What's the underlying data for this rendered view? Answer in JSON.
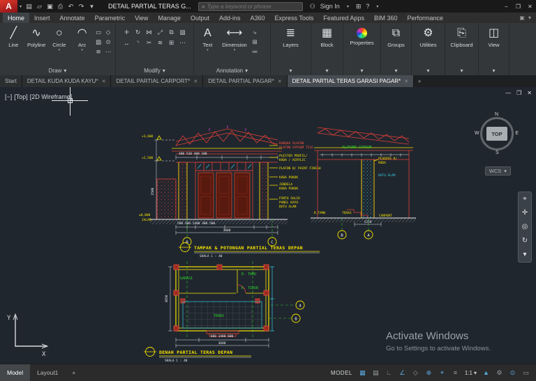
{
  "colors": {
    "viewport_bg": "#20262e",
    "cad_red": "#e04038",
    "cad_yellow": "#f5e400",
    "cad_cyan": "#35cbe0",
    "cad_green": "#2ad42a",
    "cad_white": "#e8edf1",
    "status_active_blue": "#57a8e0",
    "logo_red": "#c42b1c"
  },
  "titlebar": {
    "logo": "A",
    "logo_caret": "▾",
    "qa": [
      {
        "glyph": "▤",
        "name": "new"
      },
      {
        "glyph": "▱",
        "name": "open"
      },
      {
        "glyph": "▣",
        "name": "save"
      },
      {
        "glyph": "⎙",
        "name": "plot"
      },
      {
        "glyph": "↶",
        "name": "undo"
      },
      {
        "glyph": "↷",
        "name": "redo"
      },
      {
        "glyph": "▾",
        "name": "customize"
      }
    ],
    "title": "DETAIL PARTIAL TERAS G...",
    "search": {
      "icon": "⌕",
      "placeholder": "Type a keyword or phrase"
    },
    "user_icon": "⚇",
    "signin": "Sign In",
    "signin_caret": "▾",
    "apps_icon": "⊞",
    "help": "?",
    "help_caret": "▾",
    "win": {
      "min": "–",
      "restore": "❐",
      "close": "✕"
    }
  },
  "ribbon": {
    "tabs": [
      "Home",
      "Insert",
      "Annotate",
      "Parametric",
      "View",
      "Manage",
      "Output",
      "Add-ins",
      "A360",
      "Express Tools",
      "Featured Apps",
      "BIM 360",
      "Performance"
    ],
    "end_icons": [
      {
        "glyph": "▣",
        "name": "ribbon-display"
      },
      {
        "glyph": "▾",
        "name": "ribbon-options"
      }
    ],
    "draw": {
      "label": "Draw",
      "caret": "▾",
      "buttons": [
        {
          "glyph": "╱",
          "label": "Line"
        },
        {
          "glyph": "∿",
          "label": "Polyline"
        },
        {
          "glyph": "○",
          "label": "Circle"
        },
        {
          "glyph": "◠",
          "label": "Arc"
        }
      ],
      "extra": [
        "▭",
        "◇",
        "▨",
        "⊙",
        "≋",
        "⋯"
      ]
    },
    "modify": {
      "label": "Modify",
      "caret": "▾",
      "grid": [
        "✛",
        "↻",
        "⋈",
        "⤢",
        "⧉",
        "▨",
        "↔",
        "◝",
        "✂",
        "≋",
        "⊞",
        "⋯"
      ]
    },
    "annotation": {
      "label": "Annotation",
      "caret": "▾",
      "text": {
        "glyph": "A",
        "label": "Text"
      },
      "dim": {
        "glyph": "⟷",
        "label": "Dimension"
      },
      "extra": [
        "⤷",
        "⊞",
        "≔"
      ]
    },
    "panels": [
      {
        "glyph": "≣",
        "label": "Layers"
      },
      {
        "glyph": "▦",
        "label": "Block"
      },
      {
        "glyph": "",
        "label": "Properties"
      },
      {
        "glyph": "⧉",
        "label": "Groups"
      },
      {
        "glyph": "⚙",
        "label": "Utilities"
      },
      {
        "glyph": "⎘",
        "label": "Clipboard"
      },
      {
        "glyph": "◫",
        "label": "View"
      }
    ],
    "panel_caret": "▾"
  },
  "file_tabs": {
    "tabs": [
      {
        "label": "Start"
      },
      {
        "label": "DETAIL KUDA KUDA KAYU*"
      },
      {
        "label": "DETAIL PARTIAL CARPORT*"
      },
      {
        "label": "DETAIL PARTIAL PAGAR*"
      },
      {
        "label": "DETAIL PARTIAL TERAS GARASI PAGAR*"
      }
    ],
    "close": "✕",
    "plus": "+"
  },
  "viewport": {
    "controls": {
      "minus": "[−]",
      "view": "[Top]",
      "style": "[2D Wireframe]"
    },
    "win": {
      "min": "—",
      "restore": "❐",
      "close": "✕"
    },
    "viewcube": {
      "n": "N",
      "e": "E",
      "s": "S",
      "w": "W",
      "top": "TOP"
    },
    "wcs": {
      "label": "WCS",
      "caret": "▾"
    },
    "navbar": [
      {
        "glyph": "⌖",
        "name": "steering-wheel"
      },
      {
        "glyph": "✛",
        "name": "pan"
      },
      {
        "glyph": "◎",
        "name": "zoom"
      },
      {
        "glyph": "↻",
        "name": "orbit"
      },
      {
        "glyph": "▾",
        "name": "more"
      }
    ],
    "ucs": {
      "x": "X",
      "y": "Y"
    },
    "watermark": {
      "line1": "Activate Windows",
      "line2": "Go to Settings to activate Windows."
    }
  },
  "drawing": {
    "marks": {
      "lvl1": "+3,600",
      "lvl2": "+2,500",
      "lvl3": "±0,000",
      "road": "JALAN"
    },
    "dims": {
      "top": "400   530   400   100",
      "left": "2500",
      "bot": "500 300   1400   300 500",
      "bot_total": "3000",
      "right": "1250",
      "plan_left": "3050",
      "plan_bot": "600         1400         600",
      "plan_total": "3600"
    },
    "notes": {
      "n1a": "RANGKA PLAFON",
      "n1b": "PLAFON GYPSUM TILE",
      "n2a": "PLESTER PROFIL/",
      "n2b": "KADA / ACRYLIC",
      "n3": "PLAFON B/ PAINT FINISH",
      "n4": "KADA POKOK",
      "n5a": "JENDELA",
      "n5b": "KADA POKOK",
      "n6a": "PINTU SOLID",
      "n6b": "PANEL KAYU",
      "n6c": "BATU ALAM",
      "gypsum": "PLAFOND GYPSUM",
      "r1": "PLUDERS R/",
      "r2": "RODA",
      "r3": "BATU ALAM"
    },
    "rooms_elev": {
      "r1": "R.TAMU",
      "r2": "TERAS",
      "r3": "CARPORT"
    },
    "plan_rooms": {
      "p1": "GARASI",
      "p2": "R. TAMU",
      "p3": "K. TIDUR",
      "p4": "TERAS"
    },
    "bubbles": {
      "b1": "B",
      "b2": "C",
      "b3": "B",
      "b4": "A",
      "b5": "4",
      "b6": "B"
    },
    "t1": "TAMPAK & POTONGAN PARTIAL TERAS DEPAN",
    "s1": "SKALA 1 : 40",
    "t2": "DENAH PARTIAL TERAS DEPAN",
    "s2": "SKALA 1 : 40"
  },
  "statusbar": {
    "model_tab": "Model",
    "layout_tab": "Layout1",
    "plus": "+",
    "model_label": "MODEL",
    "icons": [
      {
        "glyph": "▦",
        "name": "grid",
        "on": true
      },
      {
        "glyph": "▤",
        "name": "snap",
        "on": false
      },
      {
        "glyph": "∟",
        "name": "ortho",
        "on": false
      },
      {
        "glyph": "∠",
        "name": "polar",
        "on": true
      },
      {
        "glyph": "◇",
        "name": "isodraft",
        "on": false
      },
      {
        "glyph": "⊕",
        "name": "osnap",
        "on": true
      },
      {
        "glyph": "⌖",
        "name": "otrack",
        "on": true
      },
      {
        "glyph": "≡",
        "name": "lineweight",
        "on": false
      }
    ],
    "scale": {
      "value": "1:1",
      "caret": "▾"
    },
    "icons2": [
      {
        "glyph": "▲",
        "name": "annotation-scale",
        "on": true
      },
      {
        "glyph": "⚙",
        "name": "workspace",
        "on": false
      },
      {
        "glyph": "⊙",
        "name": "annotation-monitor",
        "on": true
      },
      {
        "glyph": "▭",
        "name": "clean-screen",
        "on": false
      }
    ]
  }
}
